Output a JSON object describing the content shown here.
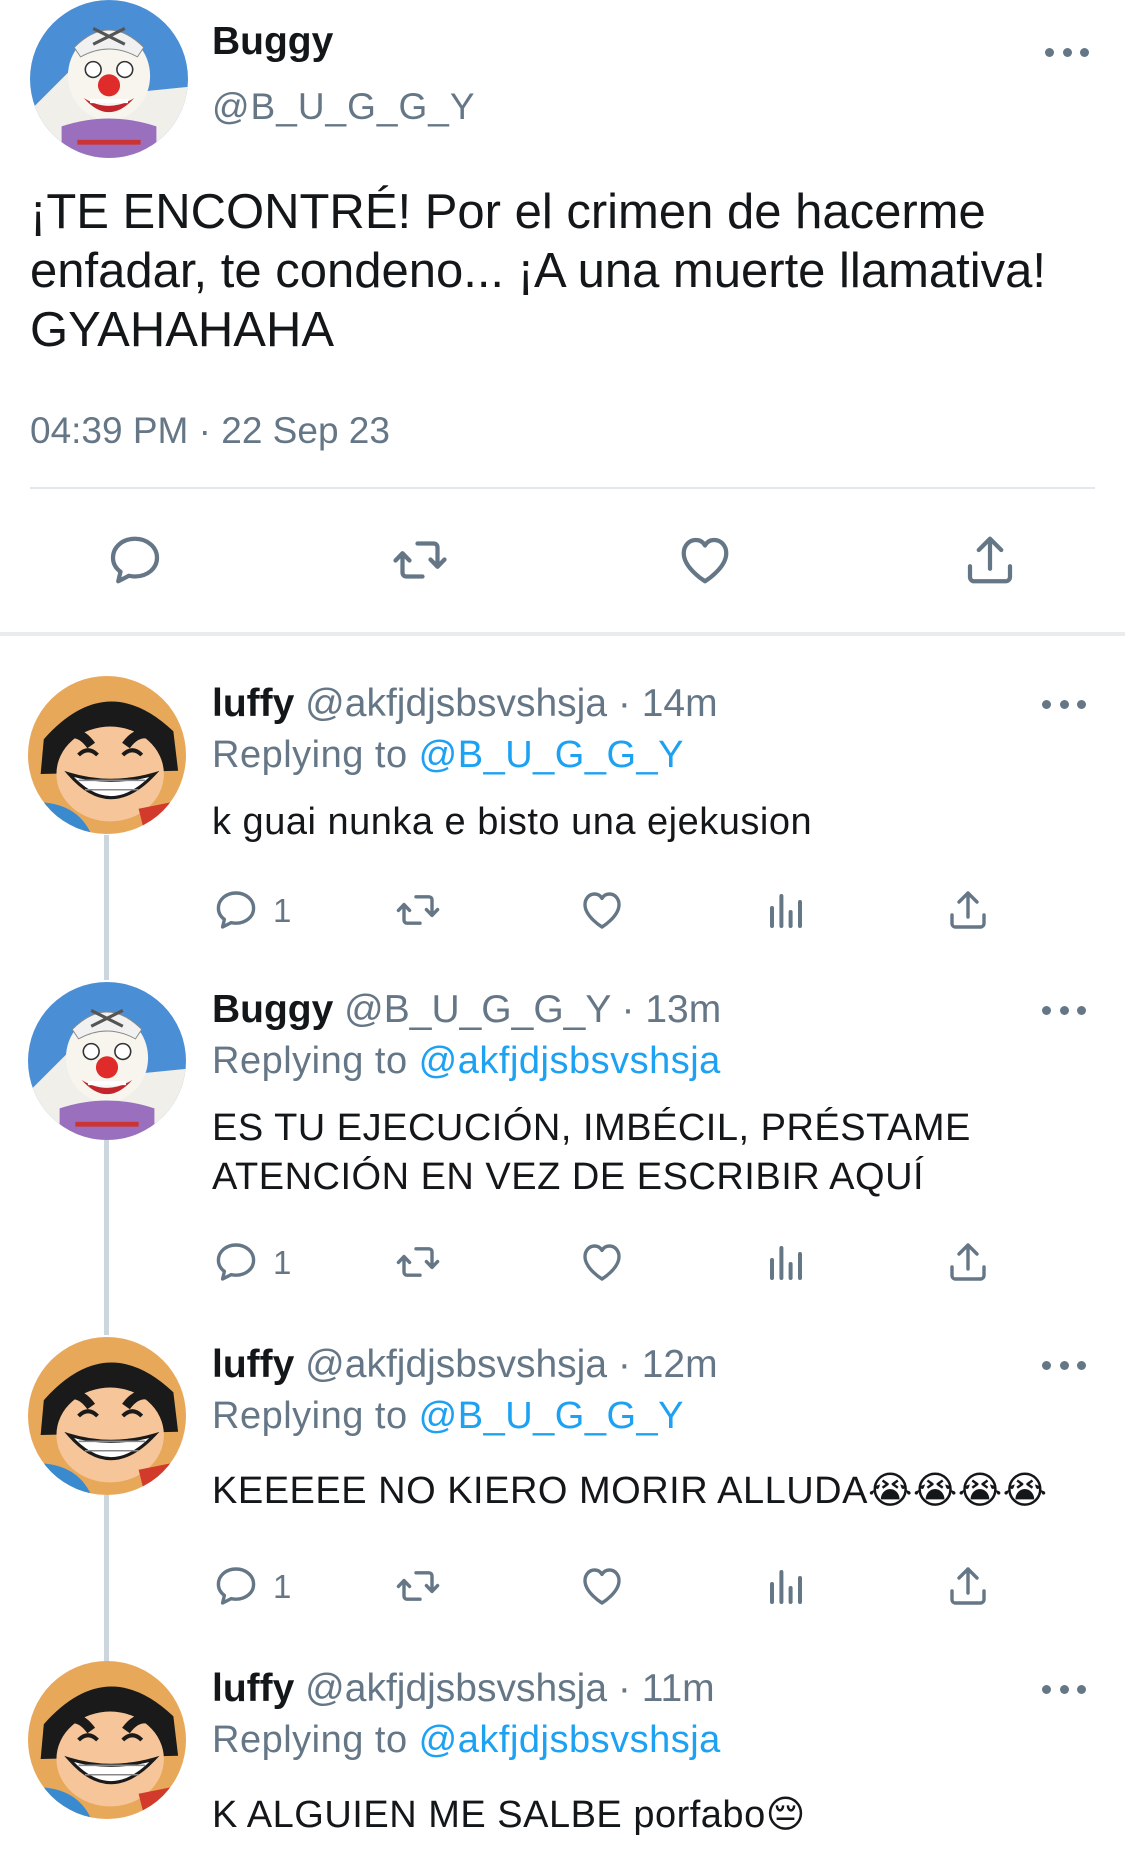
{
  "main_tweet": {
    "author_name": "Buggy",
    "author_handle": "@B_U_G_G_Y",
    "text": "¡TE ENCONTRÉ! Por el crimen de hacerme enfadar, te condeno... ¡A una muerte llamativa! GYAHAHAHA",
    "timestamp": "04:39 PM · 22 Sep 23",
    "avatar": "buggy-avatar"
  },
  "replies": [
    {
      "name": "luffy",
      "meta": " @akfjdjsbsvshsja · 14m",
      "replying_label": "Replying to ",
      "replying_to": "@B_U_G_G_Y",
      "text": "k guai nunka e bisto una ejekusion",
      "reply_count": "1",
      "avatar": "luffy-avatar"
    },
    {
      "name": "Buggy",
      "meta": " @B_U_G_G_Y · 13m",
      "replying_label": "Replying to ",
      "replying_to": "@akfjdjsbsvshsja",
      "text": "ES TU EJECUCIÓN, IMBÉCIL, PRÉSTAME ATENCIÓN EN VEZ DE ESCRIBIR AQUÍ",
      "reply_count": "1",
      "avatar": "buggy-avatar"
    },
    {
      "name": "luffy",
      "meta": " @akfjdjsbsvshsja · 12m",
      "replying_label": "Replying to ",
      "replying_to": "@B_U_G_G_Y",
      "text": "KEEEEE NO KIERO MORIR ALLUDA😭😭😭😭",
      "reply_count": "1",
      "avatar": "luffy-avatar"
    },
    {
      "name": "luffy",
      "meta": " @akfjdjsbsvshsja · 11m",
      "replying_label": "Replying to ",
      "replying_to": "@akfjdjsbsvshsja",
      "text": "K ALGUIEN ME SALBE porfabo😔",
      "avatar": "luffy-avatar"
    }
  ],
  "colors": {
    "link": "#1da1f2",
    "secondary_text": "#657786",
    "divider": "#e1e8ed"
  },
  "icons": [
    "more-icon",
    "reply-icon",
    "retweet-icon",
    "like-icon",
    "share-icon",
    "analytics-icon"
  ]
}
